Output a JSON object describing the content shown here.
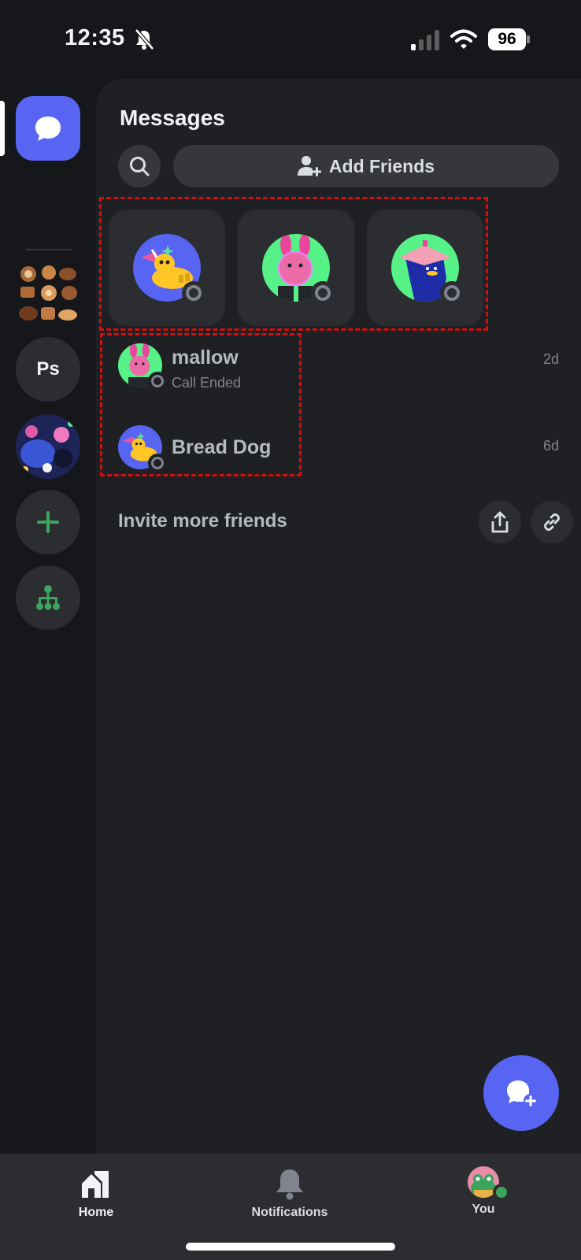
{
  "status_bar": {
    "time": "12:35",
    "battery": "96",
    "icons": [
      "bell-slash-icon",
      "signal-icon",
      "wifi-icon",
      "battery-icon"
    ]
  },
  "rail": {
    "items": [
      {
        "name": "direct-messages",
        "icon": "chat-bubble-icon",
        "selected": true
      },
      {
        "name": "bakery-server",
        "icon": "pastries-image"
      },
      {
        "name": "ps-server",
        "label": "Ps"
      },
      {
        "name": "art-server",
        "icon": "illustration-image"
      },
      {
        "name": "add-server",
        "icon": "plus-icon"
      },
      {
        "name": "discover",
        "icon": "hub-icon"
      }
    ]
  },
  "messages": {
    "title": "Messages",
    "search_icon": "search-icon",
    "add_friends_label": "Add Friends",
    "add_friends_icon": "person-add-icon"
  },
  "recent_friends": [
    {
      "avatar": "dog-avatar",
      "status": "offline"
    },
    {
      "avatar": "bunny-avatar",
      "status": "offline"
    },
    {
      "avatar": "book-head-avatar",
      "status": "offline"
    }
  ],
  "dm_list": [
    {
      "name": "mallow",
      "subtitle": "Call Ended",
      "time": "2d",
      "avatar": "bunny-avatar",
      "status": "offline"
    },
    {
      "name": "Bread Dog",
      "subtitle": "",
      "time": "6d",
      "avatar": "dog-avatar",
      "status": "offline"
    }
  ],
  "invite": {
    "label": "Invite more friends",
    "share_icon": "share-icon",
    "link_icon": "link-icon"
  },
  "fab": {
    "icon": "new-message-icon"
  },
  "bottom_nav": {
    "home": "Home",
    "notifications": "Notifications",
    "you": "You"
  },
  "colors": {
    "accent": "#5865f2",
    "online": "#3ba55d",
    "highlight": "#d0100f"
  }
}
